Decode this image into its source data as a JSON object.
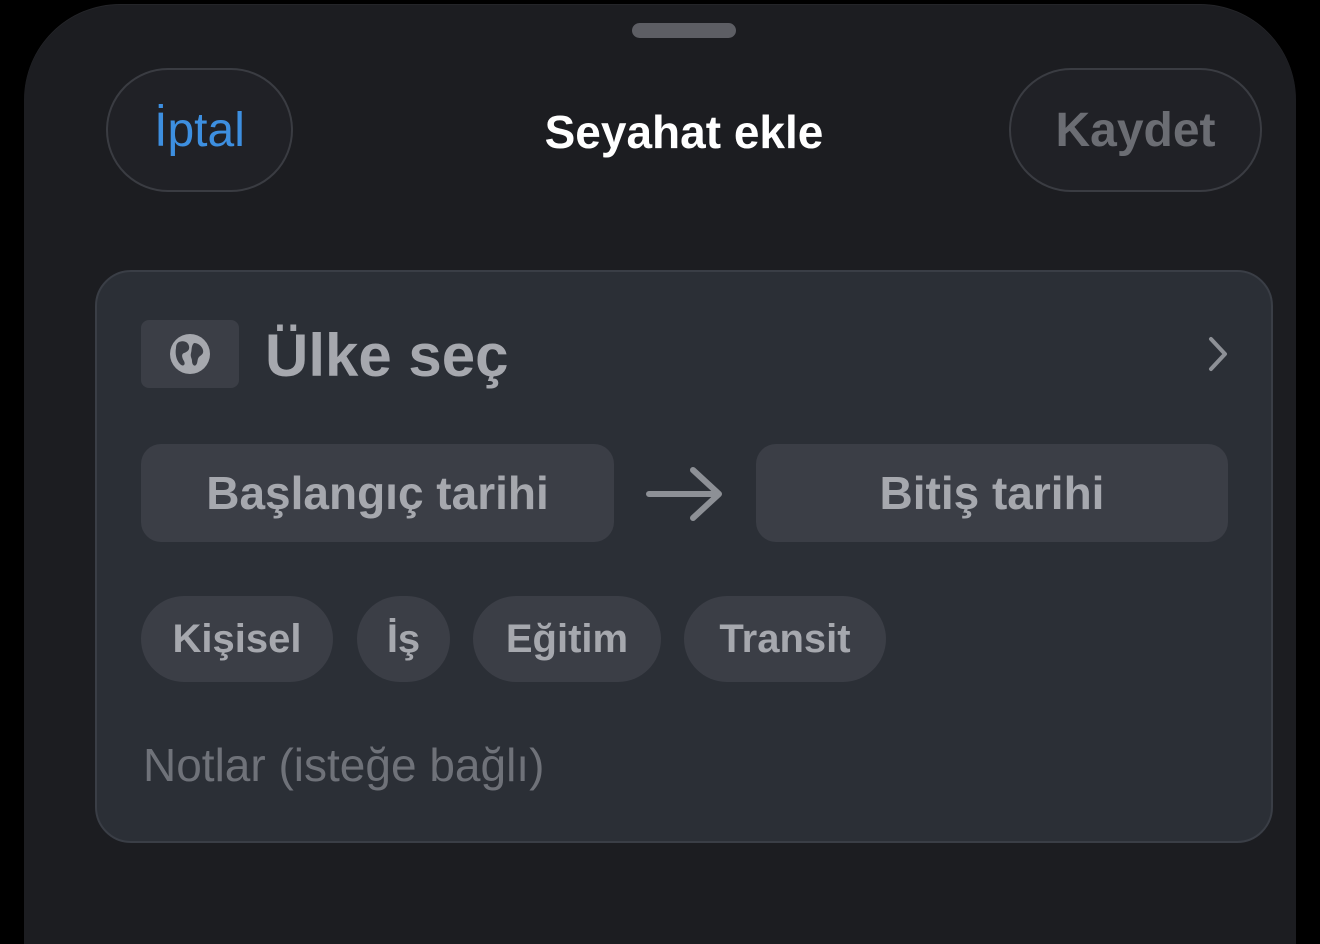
{
  "header": {
    "cancel_label": "İptal",
    "title": "Seyahat ekle",
    "save_label": "Kaydet"
  },
  "form": {
    "country_label": "Ülke seç",
    "start_date_label": "Başlangıç tarihi",
    "end_date_label": "Bitiş tarihi",
    "trip_types": [
      "Kişisel",
      "İş",
      "Eğitim",
      "Transit"
    ],
    "notes_placeholder": "Notlar (isteğe bağlı)"
  },
  "icons": {
    "country": "globe-icon",
    "country_chevron": "chevron-right-icon",
    "date_range": "arrow-right-icon"
  },
  "colors": {
    "accent": "#3d8fe0",
    "sheet": "#1c1d21",
    "card": "#2b2f36",
    "control": "#3b3e46"
  }
}
